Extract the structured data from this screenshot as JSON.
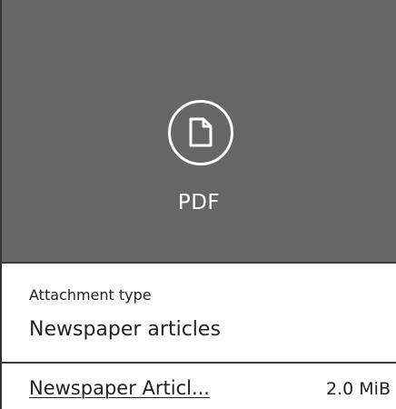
{
  "preview": {
    "icon": "pdf-file-icon",
    "file_type_label": "PDF",
    "background_color": "#666666"
  },
  "metadata": {
    "label": "Attachment type",
    "value": "Newspaper articles"
  },
  "file": {
    "name": "Newspaper Articl...",
    "size": "2.0 MiB"
  }
}
